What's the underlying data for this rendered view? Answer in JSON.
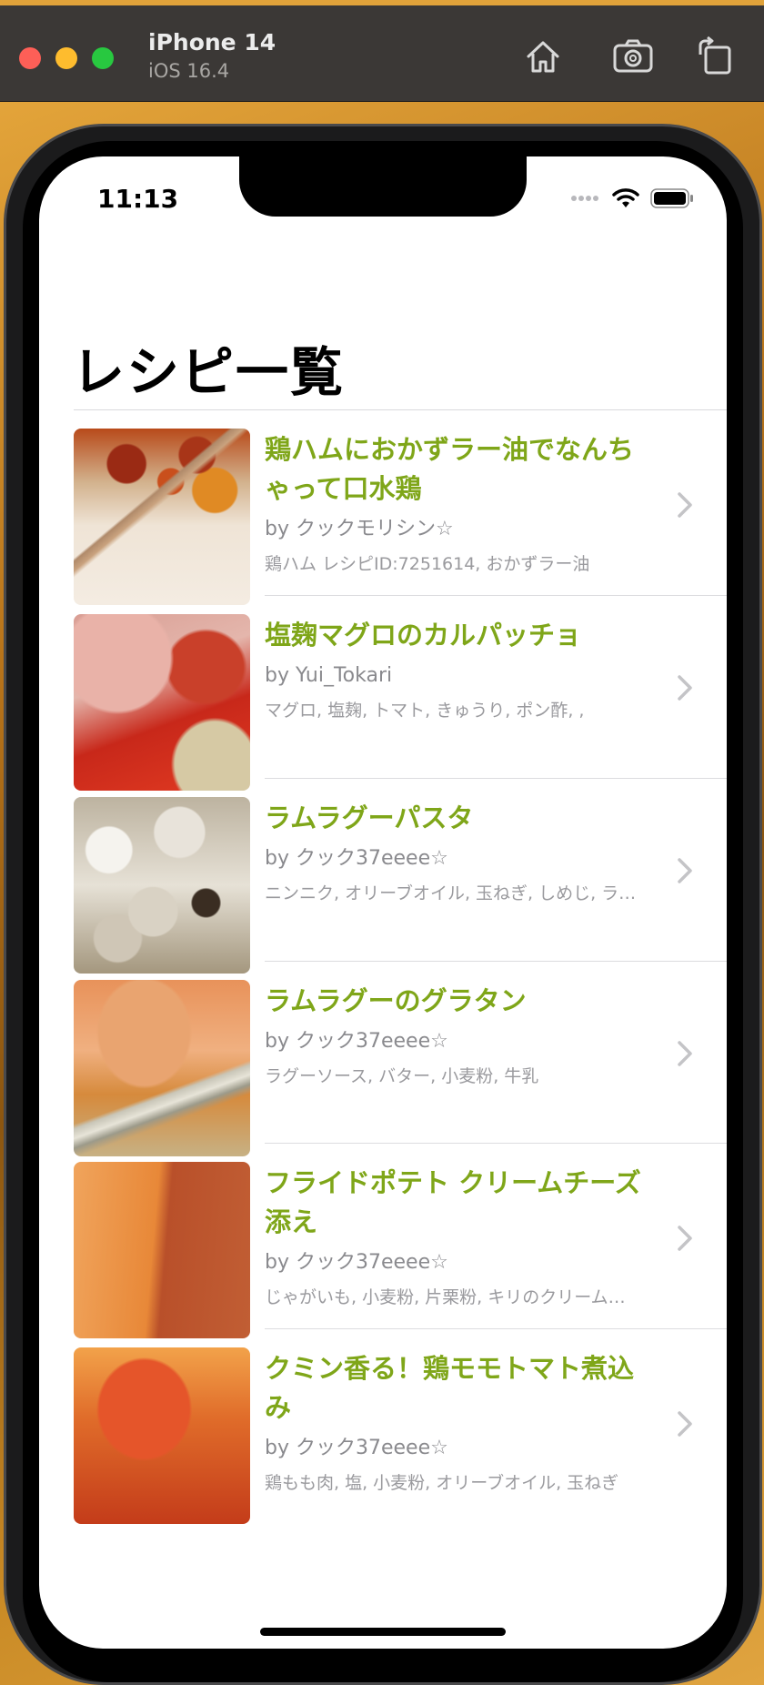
{
  "simulator": {
    "device_name": "iPhone 14",
    "os_version": "iOS 16.4"
  },
  "status_bar": {
    "time": "11:13"
  },
  "page": {
    "title": "レシピ一覧"
  },
  "recipes": [
    {
      "title": "鶏ハムにおかずラー油でなんちゃって口水鶏",
      "author": "by クックモリシン☆",
      "ingredients": "鶏ハム レシピID:7251614, おかずラー油"
    },
    {
      "title": "塩麹マグロのカルパッチョ",
      "author": "by Yui_Tokari",
      "ingredients": "マグロ, 塩麹, トマト, きゅうり, ポン酢, ,"
    },
    {
      "title": "ラムラグーパスタ",
      "author": "by クック37eeee☆",
      "ingredients": "ニンニク, オリーブオイル, 玉ねぎ, しめじ, ラ…"
    },
    {
      "title": "ラムラグーのグラタン",
      "author": "by クック37eeee☆",
      "ingredients": "ラグーソース, バター, 小麦粉, 牛乳"
    },
    {
      "title": "フライドポテト クリームチーズ添え",
      "author": "by クック37eeee☆",
      "ingredients": "じゃがいも, 小麦粉, 片栗粉, キリのクリーム…"
    },
    {
      "title": "クミン香る！鶏モモトマト煮込み",
      "author": "by クック37eeee☆",
      "ingredients": "鶏もも肉, 塩, 小麦粉, オリーブオイル, 玉ねぎ"
    }
  ],
  "colors": {
    "recipe_title": "#7fa619",
    "author": "#8a8a8e"
  }
}
